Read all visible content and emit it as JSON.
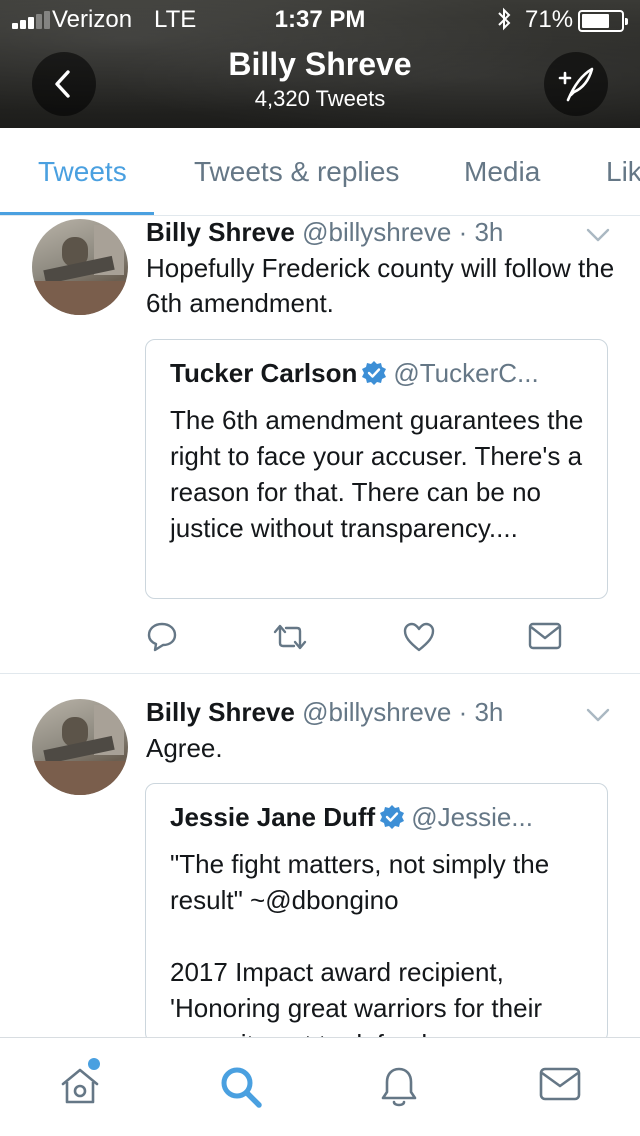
{
  "status_bar": {
    "carrier": "Verizon",
    "network": "LTE",
    "time": "1:37 PM",
    "battery_percent": "71%",
    "battery_level": 0.71,
    "signal_bars": 3
  },
  "header": {
    "name": "Billy Shreve",
    "tweet_count": "4,320 Tweets"
  },
  "tabs": [
    {
      "label": "Tweets",
      "active": true
    },
    {
      "label": "Tweets & replies",
      "active": false
    },
    {
      "label": "Media",
      "active": false
    },
    {
      "label": "Lik",
      "active": false
    }
  ],
  "tweets": [
    {
      "author": "Billy Shreve",
      "handle": "@billyshreve",
      "time": "· 3h",
      "text": "Hopefully Frederick county will follow the 6th amendment.",
      "quote": {
        "name": "Tucker Carlson",
        "handle": "@TuckerC...",
        "verified": true,
        "text": "The 6th amendment guarantees the right to face your accuser. There's a reason for that. There can be no justice without transparency...."
      }
    },
    {
      "author": "Billy Shreve",
      "handle": "@billyshreve",
      "time": "· 3h",
      "text": "Agree.",
      "quote": {
        "name": "Jessie Jane Duff",
        "handle": "@Jessie...",
        "verified": true,
        "text": "\"The fight matters, not simply the result\" ~@dbongino\n\n2017 Impact award recipient, 'Honoring great warriors for their commitment to defend"
      }
    }
  ],
  "colors": {
    "accent": "#4aa0e0",
    "verified": "#3d8fd6",
    "secondary_text": "#657786"
  },
  "icons": {
    "back": "chevron-left-icon",
    "compose": "compose-tweet-icon",
    "reply": "reply-icon",
    "retweet": "retweet-icon",
    "like": "heart-icon",
    "dm": "envelope-icon",
    "home": "home-icon",
    "search": "search-icon",
    "notifications": "bell-icon",
    "messages": "envelope-icon"
  }
}
